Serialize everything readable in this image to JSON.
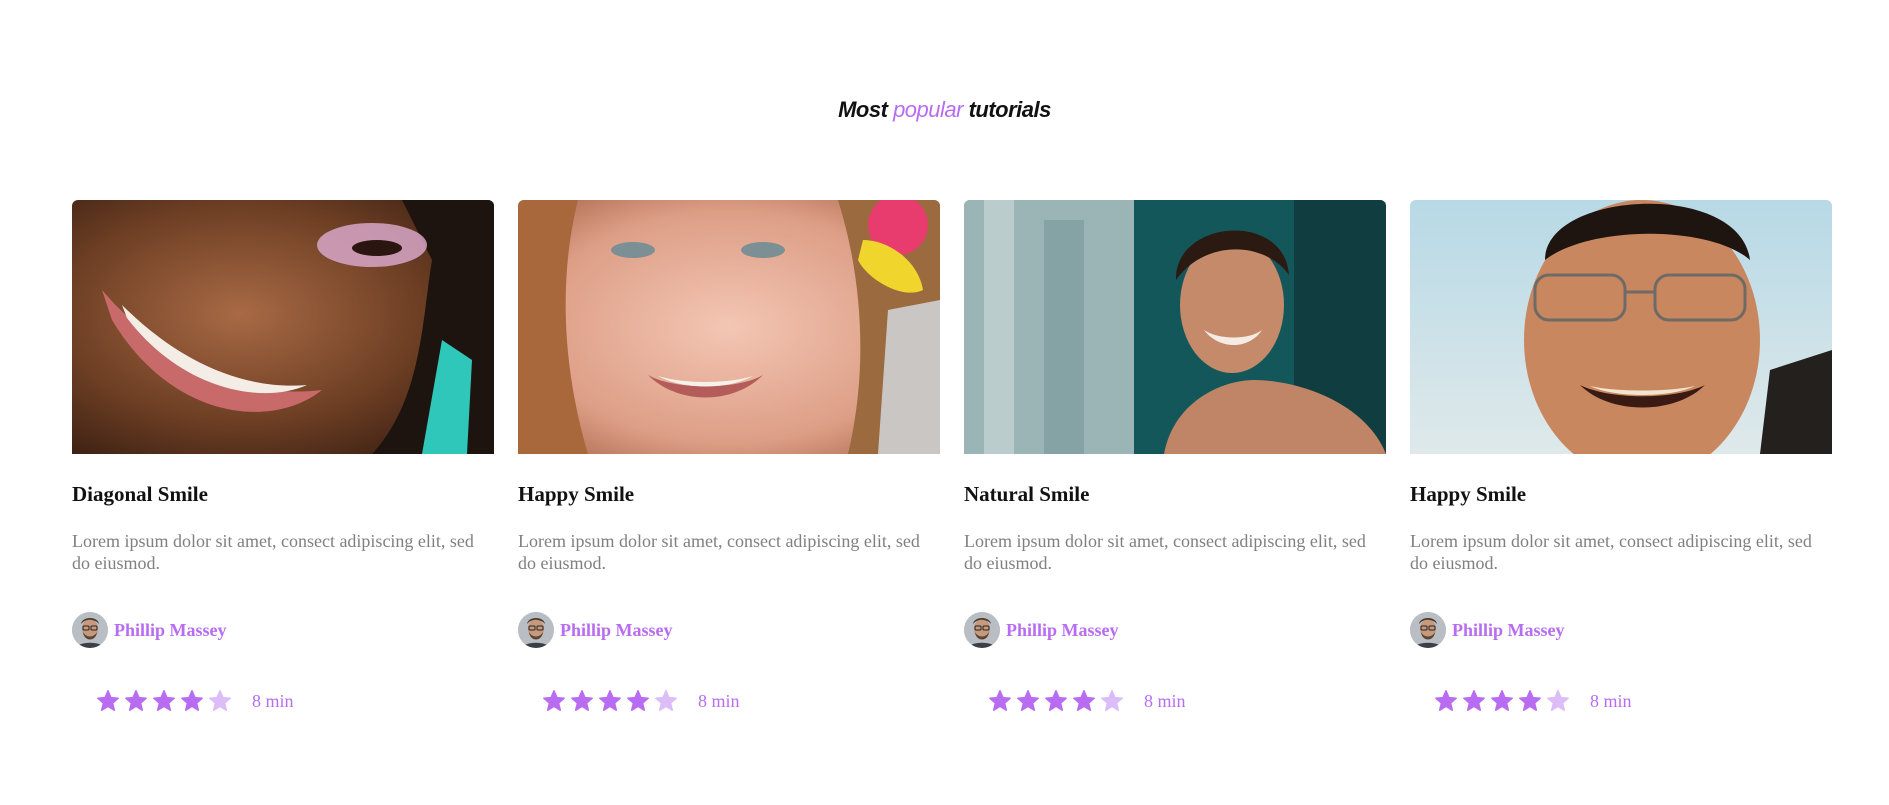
{
  "section": {
    "title_prefix": "Most",
    "title_accent": "popular",
    "title_suffix": "tutorials"
  },
  "colors": {
    "accent": "#b86cf2",
    "star_filled": "#b86cf2",
    "star_empty": "#dcbdf8",
    "title_text": "#111111",
    "body_text": "#808080"
  },
  "cards": [
    {
      "image_icon": "portrait-photo-icon",
      "title": "Diagonal Smile",
      "description": "Lorem ipsum dolor sit amet, consect adipiscing elit, sed do eiusmod.",
      "author": "Phillip Massey",
      "rating": 4,
      "rating_max": 5,
      "duration": "8 min"
    },
    {
      "image_icon": "portrait-photo-icon",
      "title": "Happy Smile",
      "description": "Lorem ipsum dolor sit amet, consect adipiscing elit, sed do eiusmod.",
      "author": "Phillip Massey",
      "rating": 4,
      "rating_max": 5,
      "duration": "8 min"
    },
    {
      "image_icon": "portrait-photo-icon",
      "title": "Natural Smile",
      "description": "Lorem ipsum dolor sit amet, consect adipiscing elit, sed do eiusmod.",
      "author": "Phillip Massey",
      "rating": 4,
      "rating_max": 5,
      "duration": "8 min"
    },
    {
      "image_icon": "portrait-photo-icon",
      "title": "Happy Smile",
      "description": "Lorem ipsum dolor sit amet, consect adipiscing elit, sed do eiusmod.",
      "author": "Phillip Massey",
      "rating": 4,
      "rating_max": 5,
      "duration": "8 min"
    }
  ]
}
